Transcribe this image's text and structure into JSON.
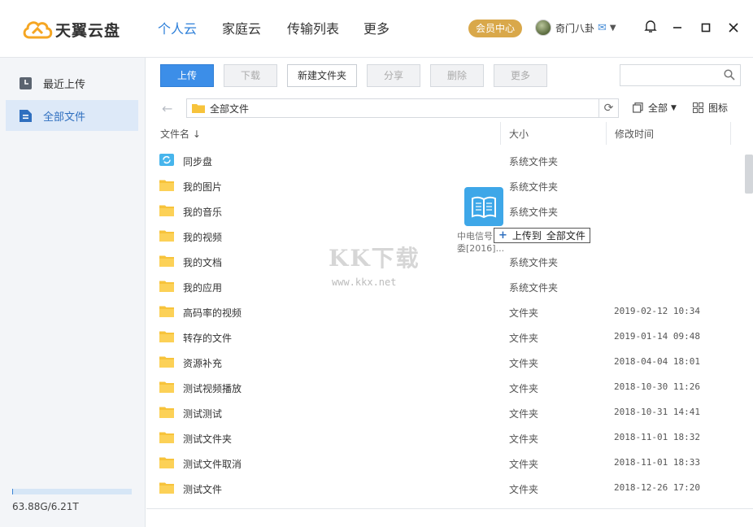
{
  "app": {
    "name": "天翼云盘",
    "nav": [
      {
        "label": "个人云",
        "active": true
      },
      {
        "label": "家庭云",
        "active": false
      },
      {
        "label": "传输列表",
        "active": false
      },
      {
        "label": "更多",
        "active": false
      }
    ],
    "vip_label": "会员中心",
    "user_name": "奇门八卦",
    "accent_color": "#2d7fd9"
  },
  "sidebar": {
    "items": [
      {
        "label": "最近上传",
        "icon": "clock-icon",
        "active": false
      },
      {
        "label": "全部文件",
        "icon": "file-icon",
        "active": true
      }
    ],
    "quota_text": "63.88G/6.21T",
    "quota_fraction": 0.01
  },
  "toolbar": {
    "upload": "上传",
    "download": "下载",
    "new_folder": "新建文件夹",
    "share": "分享",
    "delete": "删除",
    "more": "更多",
    "search_placeholder": ""
  },
  "pathbar": {
    "path": "全部文件",
    "filter_label": "全部",
    "view_label": "图标"
  },
  "list": {
    "headers": {
      "name": "文件名 ↓",
      "size": "大小",
      "modified": "修改时间"
    },
    "rows": [
      {
        "name": "同步盘",
        "size": "系统文件夹",
        "modified": "",
        "icon": "sync-folder-icon"
      },
      {
        "name": "我的图片",
        "size": "系统文件夹",
        "modified": "",
        "icon": "folder-icon"
      },
      {
        "name": "我的音乐",
        "size": "系统文件夹",
        "modified": "",
        "icon": "folder-icon"
      },
      {
        "name": "我的视频",
        "size": "",
        "modified": "",
        "icon": "folder-icon"
      },
      {
        "name": "我的文档",
        "size": "系统文件夹",
        "modified": "",
        "icon": "folder-icon"
      },
      {
        "name": "我的应用",
        "size": "系统文件夹",
        "modified": "",
        "icon": "folder-icon"
      },
      {
        "name": "高码率的视频",
        "size": "文件夹",
        "modified": "2019-02-12 10:34",
        "icon": "folder-icon"
      },
      {
        "name": "转存的文件",
        "size": "文件夹",
        "modified": "2019-01-14 09:48",
        "icon": "folder-icon"
      },
      {
        "name": "资源补充",
        "size": "文件夹",
        "modified": "2018-04-04 18:01",
        "icon": "folder-icon"
      },
      {
        "name": "测试视频播放",
        "size": "文件夹",
        "modified": "2018-10-30 11:26",
        "icon": "folder-icon"
      },
      {
        "name": "测试测试",
        "size": "文件夹",
        "modified": "2018-10-31 14:41",
        "icon": "folder-icon"
      },
      {
        "name": "测试文件夹",
        "size": "文件夹",
        "modified": "2018-11-01 18:32",
        "icon": "folder-icon"
      },
      {
        "name": "测试文件取消",
        "size": "文件夹",
        "modified": "2018-11-01 18:33",
        "icon": "folder-icon"
      },
      {
        "name": "测试文件",
        "size": "文件夹",
        "modified": "2018-12-26 17:20",
        "icon": "folder-icon"
      }
    ]
  },
  "drag": {
    "file_label": "中电信号...\n委[2016]...",
    "tip_action": "上传到",
    "tip_dest": "全部文件"
  },
  "watermark": {
    "text": "KK下载",
    "url": "www.kkx.net"
  }
}
